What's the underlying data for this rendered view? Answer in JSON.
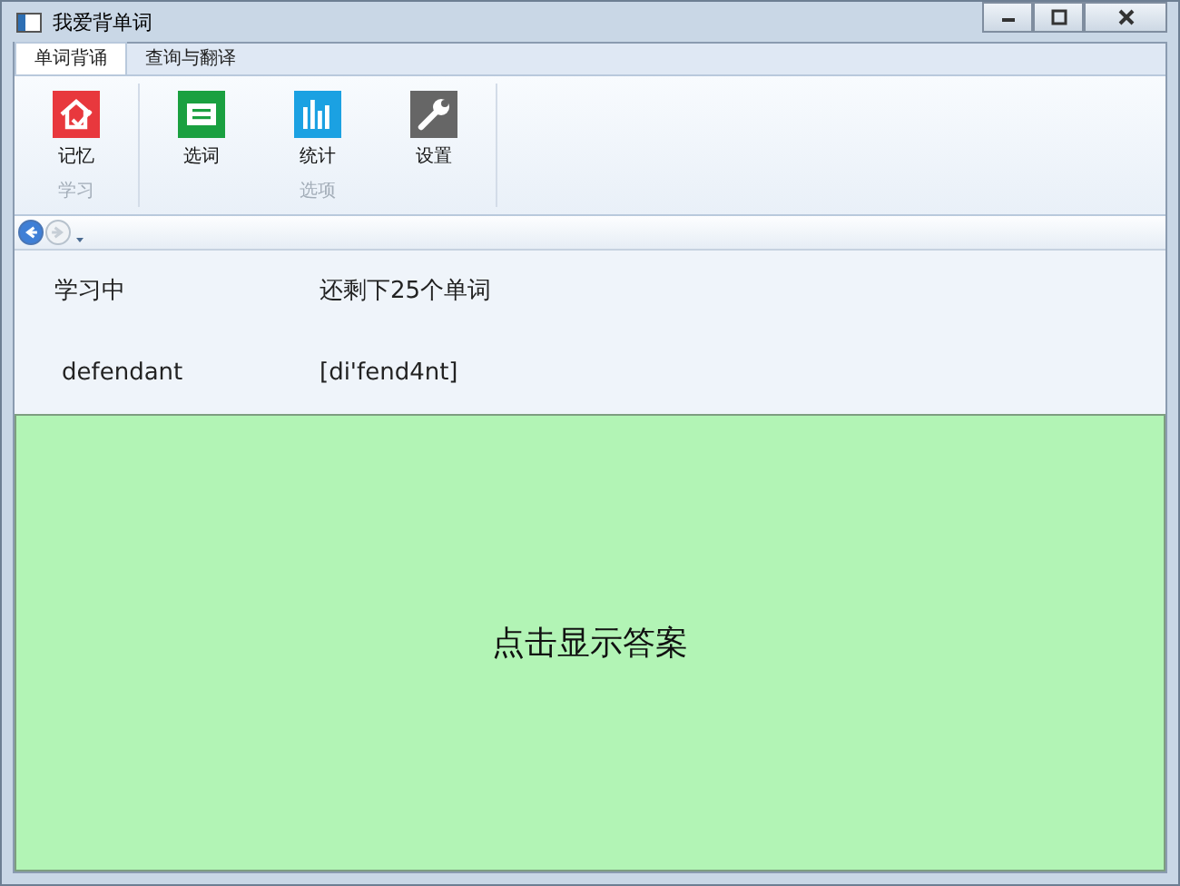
{
  "window": {
    "title": "我爱背单词"
  },
  "tabs": [
    {
      "label": "单词背诵",
      "selected": true
    },
    {
      "label": "查询与翻译",
      "selected": false
    }
  ],
  "ribbon": {
    "groups": [
      {
        "label": "学习",
        "buttons": [
          {
            "label": "记忆",
            "kind": "memory"
          }
        ]
      },
      {
        "label": "选项",
        "buttons": [
          {
            "label": "选词",
            "kind": "select"
          },
          {
            "label": "统计",
            "kind": "stats"
          },
          {
            "label": "设置",
            "kind": "settings"
          }
        ]
      }
    ]
  },
  "nav": {
    "back": {
      "disabled": false
    },
    "forward": {
      "disabled": true
    }
  },
  "status": {
    "label": "学习中",
    "remaining": "还剩下25个单词"
  },
  "word": {
    "text": "defendant",
    "phonetic": "[di'fend4nt]"
  },
  "answer": {
    "label": "点击显示答案"
  }
}
